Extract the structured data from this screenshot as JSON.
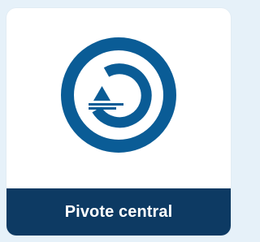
{
  "card": {
    "label": "Pivote central",
    "icon": "center-pivot-irrigation-icon"
  },
  "colors": {
    "background": "#e6f1f9",
    "card": "#ffffff",
    "icon": "#0a5c96",
    "label_bar": "#0d3a63",
    "label_text": "#ffffff"
  }
}
